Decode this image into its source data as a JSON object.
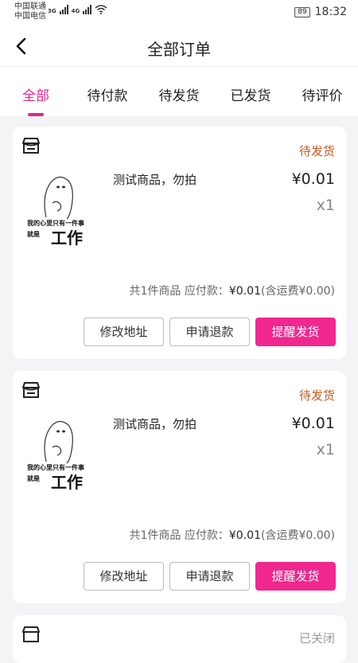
{
  "status_bar": {
    "carrier1": "中国联通",
    "carrier2": "中国电信",
    "net1": "3G",
    "net2": "4G",
    "battery": "89",
    "time": "18:32"
  },
  "header": {
    "title": "全部订单"
  },
  "tabs": [
    {
      "label": "全部",
      "active": true
    },
    {
      "label": "待付款",
      "active": false
    },
    {
      "label": "待发货",
      "active": false
    },
    {
      "label": "已发货",
      "active": false
    },
    {
      "label": "待评价",
      "active": false
    }
  ],
  "orders": [
    {
      "status": "待发货",
      "product_name": "测试商品，勿拍",
      "price": "¥0.01",
      "qty": "x1",
      "image_text": {
        "line1": "我的心里只有一件事",
        "line2": "就是",
        "big": "工作"
      },
      "summary_count": "共1件商品",
      "summary_label": "应付款：",
      "summary_amount": "¥0.01",
      "summary_shipping": "(含运费¥0.00)",
      "buttons": {
        "modify_address": "修改地址",
        "refund": "申请退款",
        "remind": "提醒发货"
      }
    },
    {
      "status": "待发货",
      "product_name": "测试商品，勿拍",
      "price": "¥0.01",
      "qty": "x1",
      "image_text": {
        "line1": "我的心里只有一件事",
        "line2": "就是",
        "big": "工作"
      },
      "summary_count": "共1件商品",
      "summary_label": "应付款：",
      "summary_amount": "¥0.01",
      "summary_shipping": "(含运费¥0.00)",
      "buttons": {
        "modify_address": "修改地址",
        "refund": "申请退款",
        "remind": "提醒发货"
      }
    }
  ],
  "partial_order": {
    "status": "已关闭"
  },
  "colors": {
    "accent": "#e6248c",
    "status_pending": "#c8581f"
  }
}
